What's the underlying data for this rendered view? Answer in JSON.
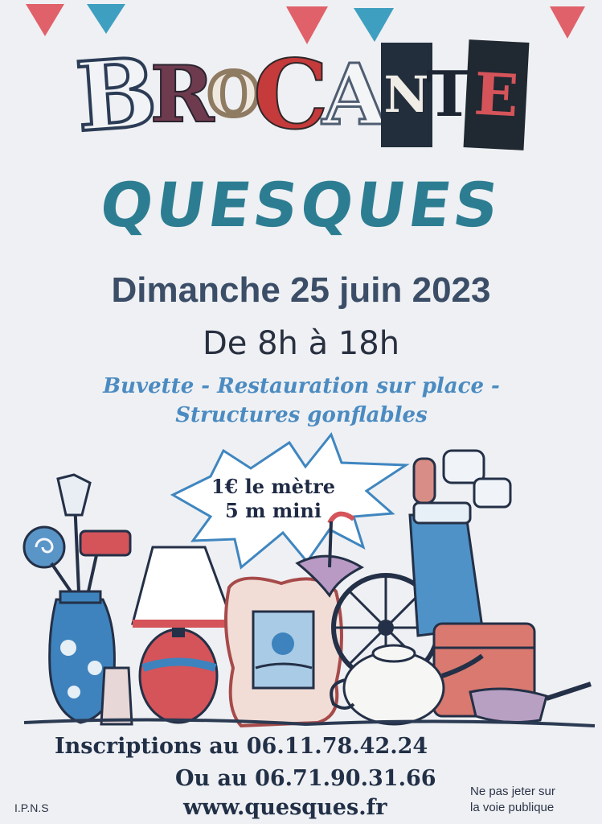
{
  "poster": {
    "title": "BROCANTE",
    "title_letters": [
      "B",
      "R",
      "O",
      "C",
      "A",
      "N",
      "T",
      "E"
    ],
    "town": "QUESQUES",
    "date": "Dimanche 25 juin 2023",
    "hours": "De 8h à 18h",
    "services_line1": "Buvette - Restauration sur place -",
    "services_line2": "Structures gonflables",
    "price_line1": "1€ le mètre",
    "price_line2": "5 m mini",
    "contact_line1": "Inscriptions au 06.11.78.42.24",
    "contact_line2": "Ou au 06.71.90.31.66",
    "website": "www.quesques.fr",
    "ipns": "I.P.N.S",
    "notice_line1": "Ne pas jeter sur",
    "notice_line2": "la voie publique"
  },
  "colors": {
    "bunting_red": "#e0616a",
    "bunting_blue": "#3f9fc0",
    "town_teal": "#2d7d92",
    "services_blue": "#4b8bc1"
  },
  "illustration": {
    "items": [
      "vase-icon",
      "lamp-icon",
      "picture-frame-icon",
      "wheel-icon",
      "teapot-icon",
      "golf-bag-icon",
      "umbrella-icon",
      "suitcase-icon",
      "pan-icon"
    ]
  }
}
